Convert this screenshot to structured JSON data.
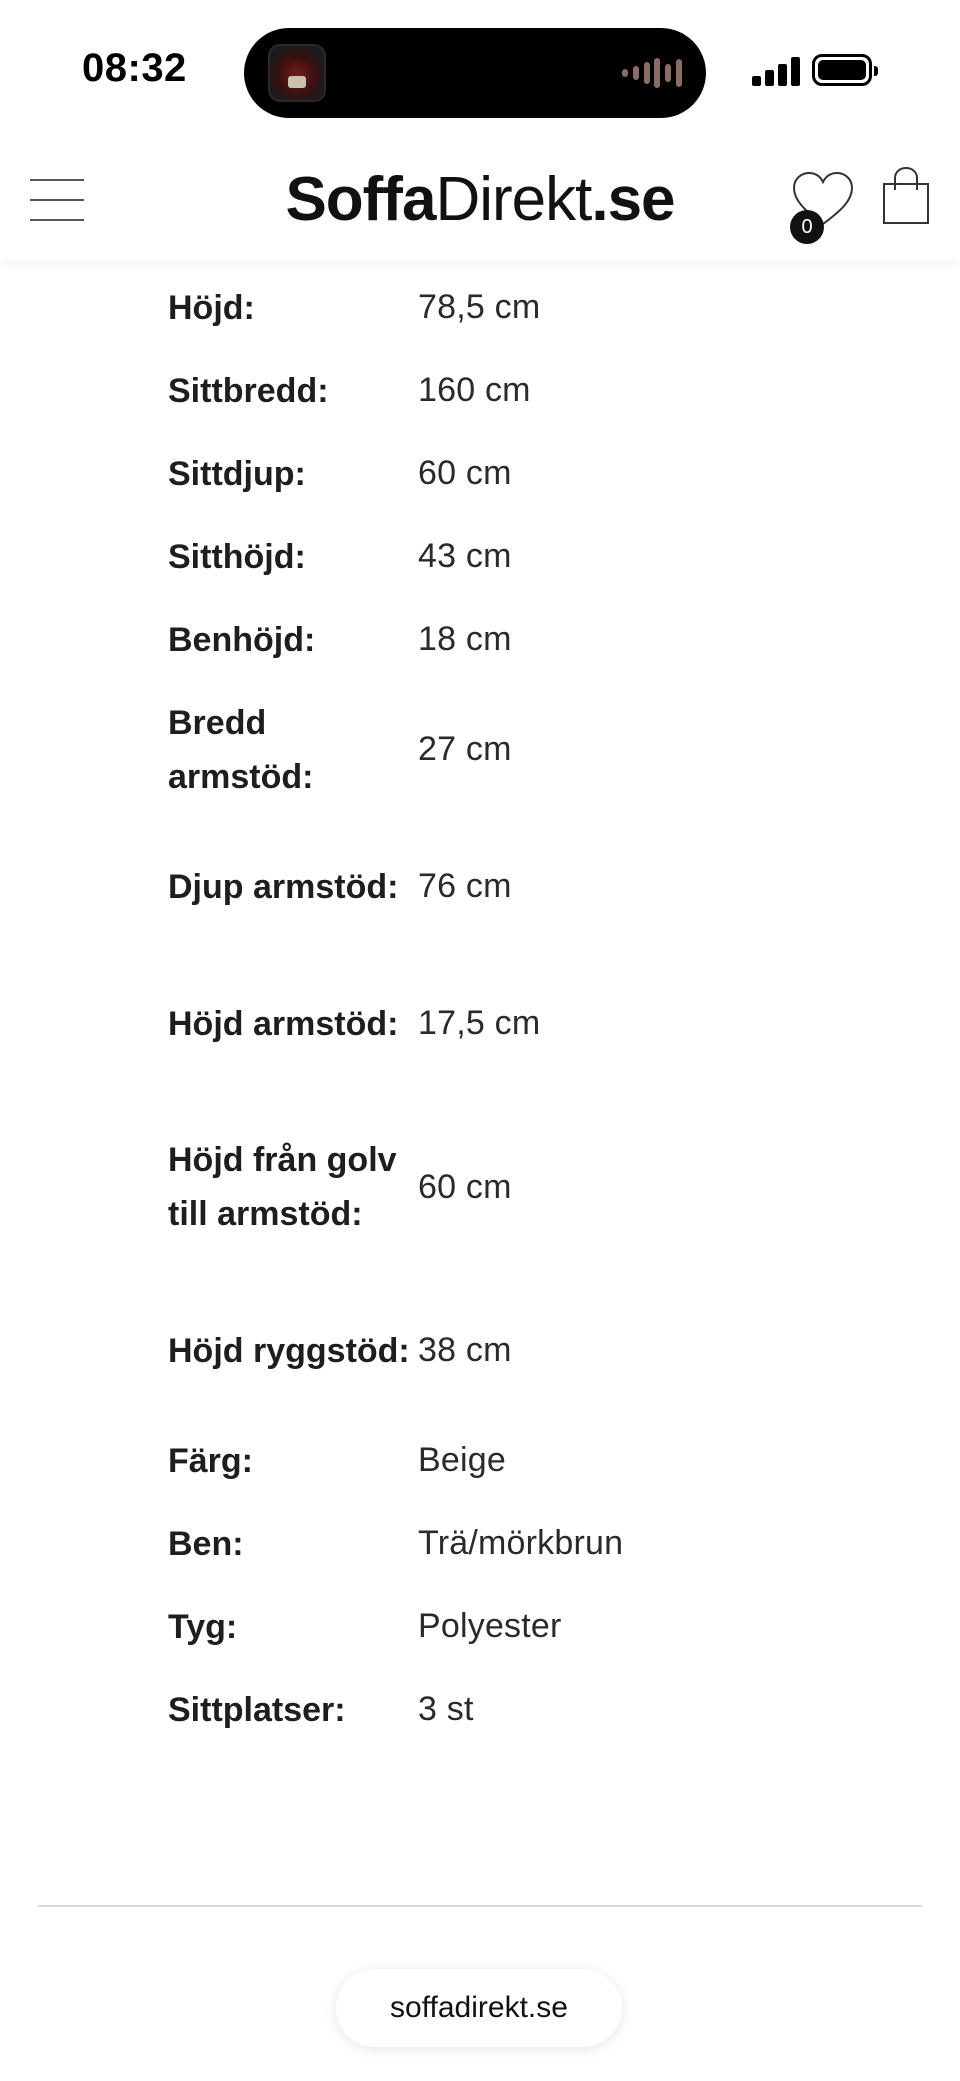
{
  "status_bar": {
    "time": "08:32"
  },
  "header": {
    "logo_bold": "Soffa",
    "logo_light": "Direkt",
    "logo_suffix": ".se",
    "wishlist_count": "0",
    "icons": [
      "menu-icon",
      "heart-icon",
      "shopping-bag-icon"
    ]
  },
  "specs": [
    {
      "label": "Höjd:",
      "value": "78,5 cm"
    },
    {
      "label": "Sittbredd:",
      "value": "160 cm"
    },
    {
      "label": "Sittdjup:",
      "value": "60 cm"
    },
    {
      "label": "Sitthöjd:",
      "value": "43 cm"
    },
    {
      "label": "Benhöjd:",
      "value": "18 cm"
    },
    {
      "label": "Bredd armstöd:",
      "value": "27 cm"
    },
    {
      "label": "Djup armstöd:",
      "value": "76 cm"
    },
    {
      "label": "Höjd armstöd:",
      "value": "17,5 cm"
    },
    {
      "label": "Höjd från golv till armstöd:",
      "value": "60 cm"
    },
    {
      "label": "Höjd ryggstöd:",
      "value": "38 cm"
    },
    {
      "label": "Färg:",
      "value": "Beige"
    },
    {
      "label": "Ben:",
      "value": "Trä/mörkbrun"
    },
    {
      "label": "Tyg:",
      "value": "Polyester"
    },
    {
      "label": "Sittplatser:",
      "value": "3 st"
    }
  ],
  "browser": {
    "url": "soffadirekt.se"
  }
}
